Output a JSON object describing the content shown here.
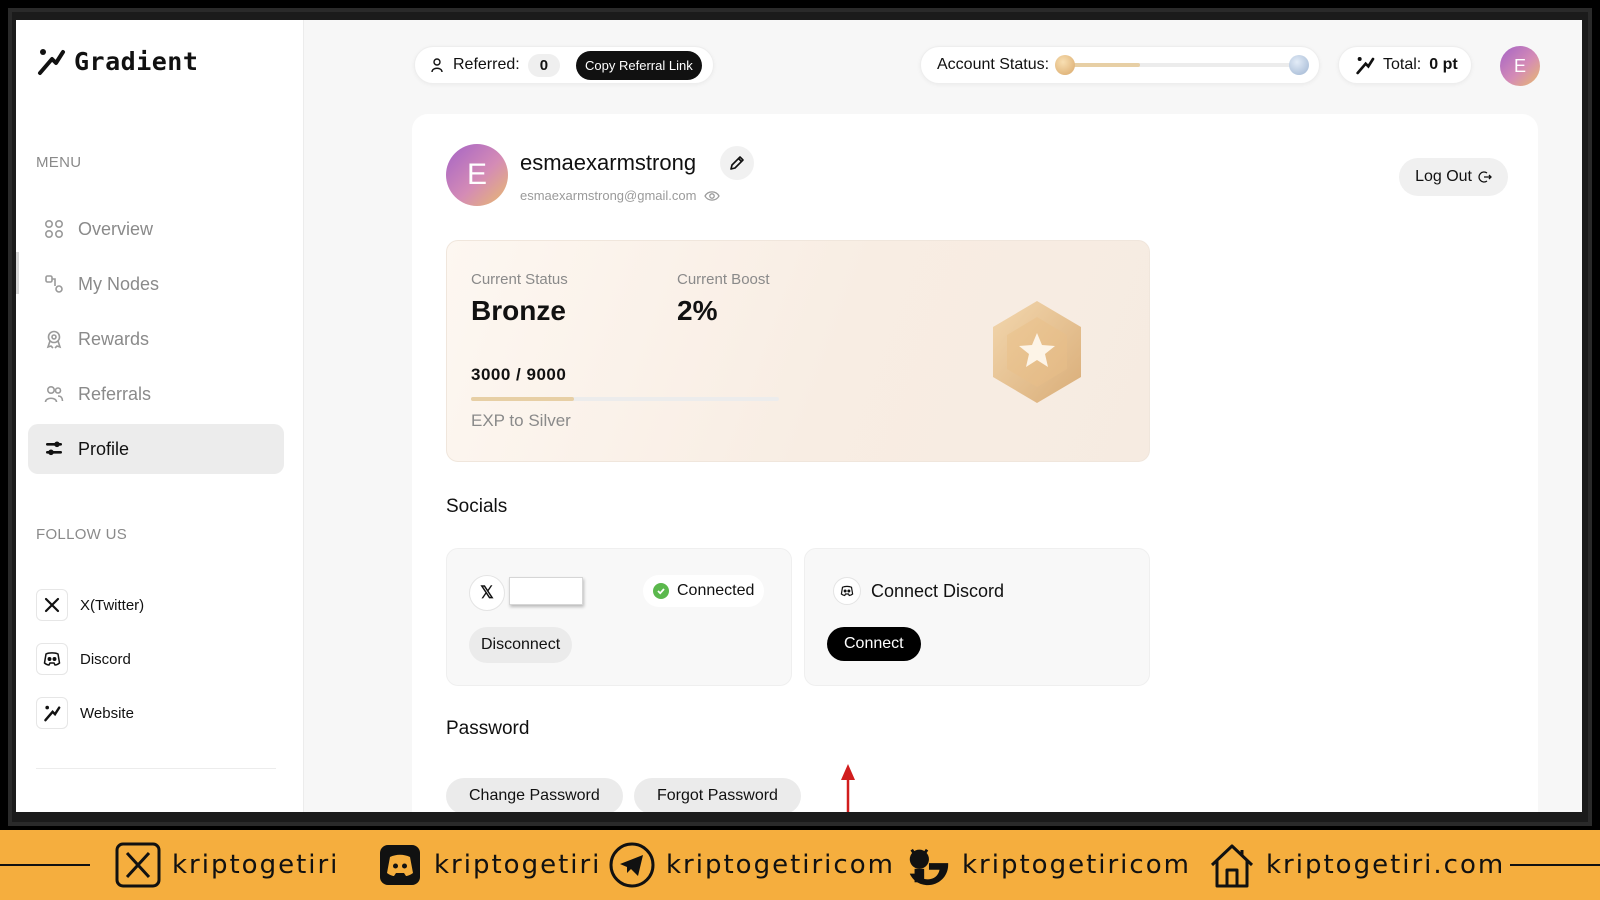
{
  "app": {
    "name": "Gradient"
  },
  "sidebar": {
    "menu_label": "MENU",
    "items": [
      {
        "label": "Overview",
        "icon": "grid-icon"
      },
      {
        "label": "My Nodes",
        "icon": "nodes-icon"
      },
      {
        "label": "Rewards",
        "icon": "award-icon"
      },
      {
        "label": "Referrals",
        "icon": "users-icon"
      },
      {
        "label": "Profile",
        "icon": "sliders-icon",
        "active": true
      }
    ],
    "follow_label": "FOLLOW US",
    "follow": [
      {
        "label": "X(Twitter)",
        "icon": "x-icon"
      },
      {
        "label": "Discord",
        "icon": "discord-icon"
      },
      {
        "label": "Website",
        "icon": "gradient-logo-icon"
      }
    ]
  },
  "topbar": {
    "referred_label": "Referred:",
    "referred_count": "0",
    "copy_label": "Copy Referral Link",
    "account_status_label": "Account Status:",
    "account_status_progress": 0.33,
    "total_label": "Total:",
    "total_value": "0 pt",
    "avatar_initial": "E"
  },
  "profile": {
    "avatar_initial": "E",
    "username": "esmaexarmstrong",
    "email": "esmaexarmstrong@gmail.com",
    "logout_label": "Log Out",
    "current_status_label": "Current Status",
    "current_status_value": "Bronze",
    "current_boost_label": "Current Boost",
    "current_boost_value": "2%",
    "exp_text": "3000 / 9000",
    "exp_progress": 0.333,
    "exp_label": "EXP to Silver"
  },
  "socials": {
    "title": "Socials",
    "x": {
      "status": "Connected",
      "disconnect_label": "Disconnect"
    },
    "discord": {
      "title": "Connect Discord",
      "connect_label": "Connect"
    }
  },
  "password": {
    "title": "Password",
    "change_label": "Change Password",
    "forgot_label": "Forgot Password"
  },
  "banner": {
    "items": [
      {
        "icon": "x-icon",
        "text": "kriptogetiri"
      },
      {
        "icon": "discord-icon",
        "text": "kriptogetiri"
      },
      {
        "icon": "telegram-icon",
        "text": "kriptogetiricom"
      },
      {
        "icon": "github-icon",
        "text": "kriptogetiricom"
      },
      {
        "icon": "home-icon",
        "text": "kriptogetiri.com"
      }
    ]
  },
  "colors": {
    "accent": "#000000",
    "bronze": "#e7cfa5",
    "success": "#5bb84d",
    "banner": "#f5ae3e"
  }
}
